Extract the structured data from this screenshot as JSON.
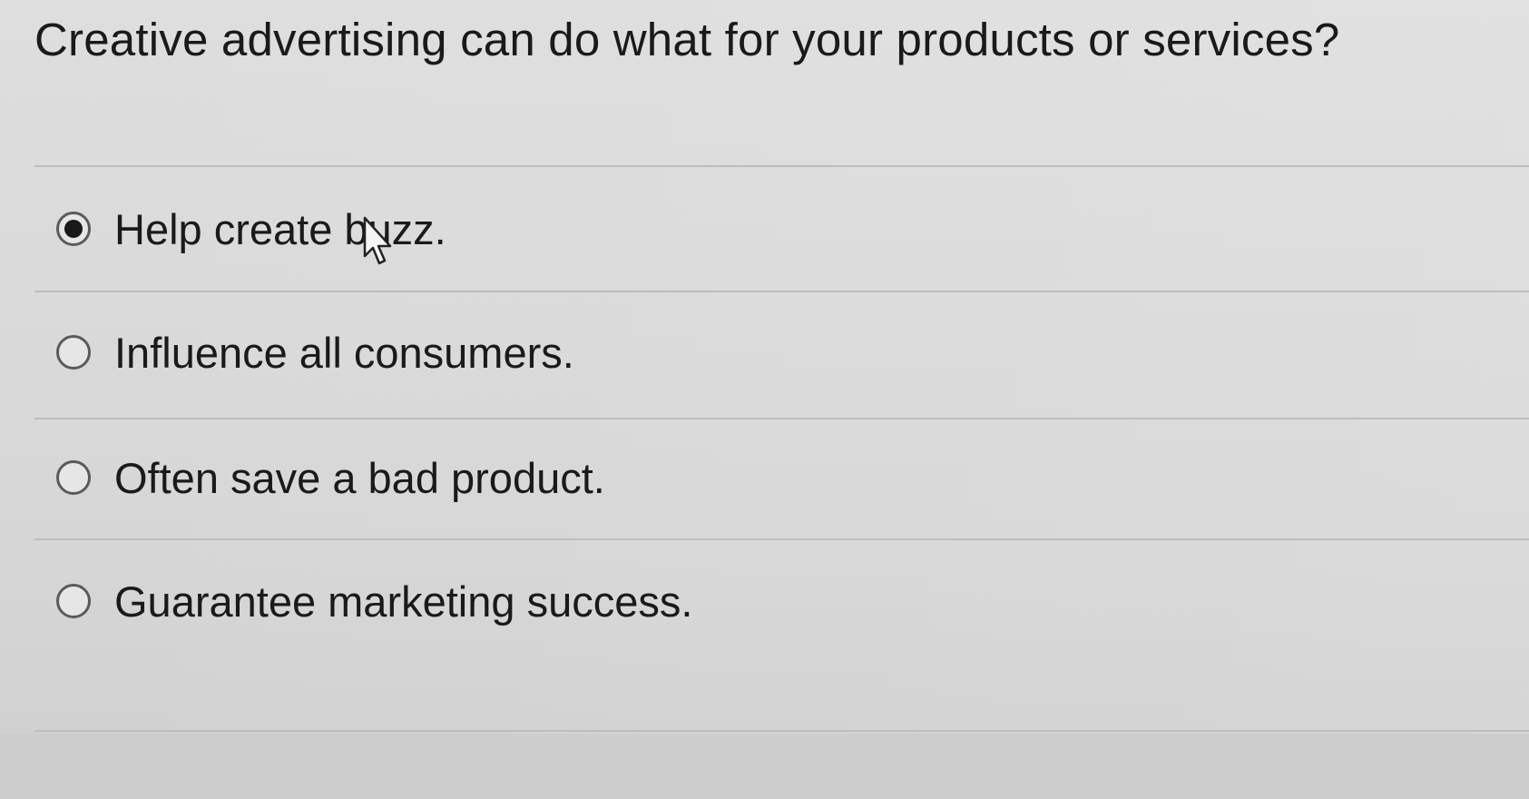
{
  "quiz": {
    "question": "Creative advertising can do what for your products or services?",
    "options": [
      {
        "label": "Help create buzz.",
        "selected": true
      },
      {
        "label": "Influence all consumers.",
        "selected": false
      },
      {
        "label": "Often save a bad product.",
        "selected": false
      },
      {
        "label": "Guarantee marketing success.",
        "selected": false
      }
    ]
  },
  "pointer": {
    "icon": "mouse-pointer-icon"
  }
}
